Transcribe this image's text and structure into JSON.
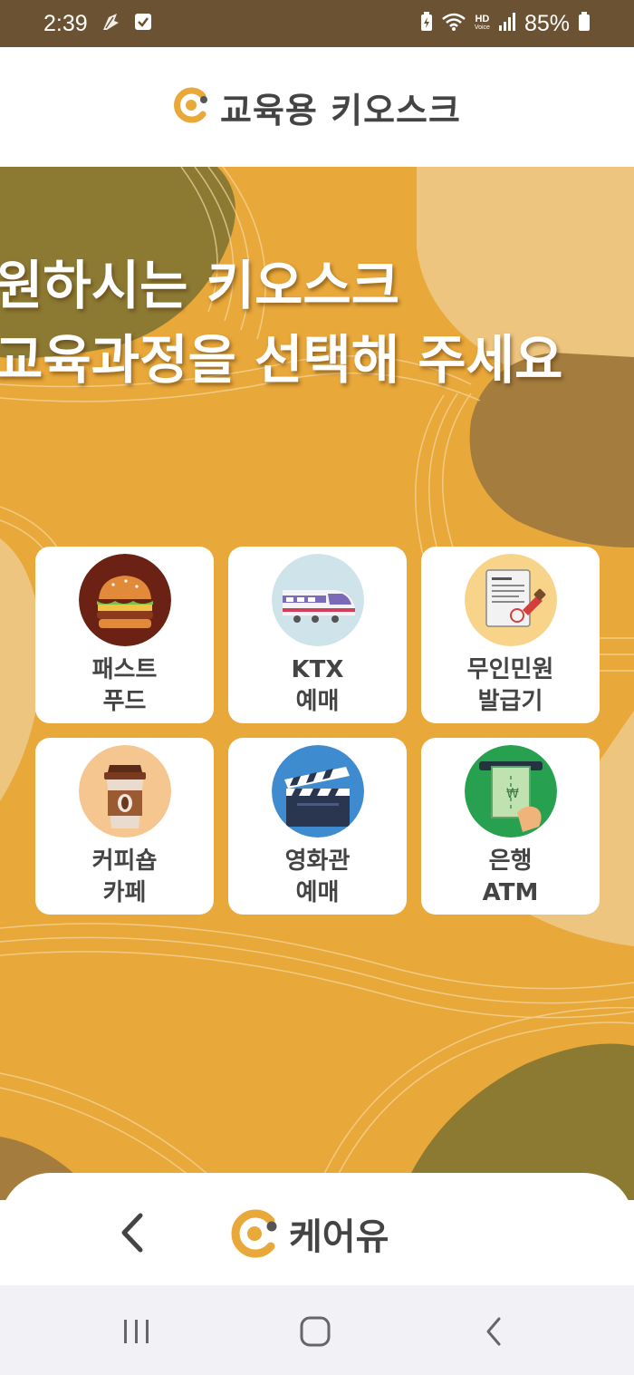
{
  "status_bar": {
    "time": "2:39",
    "battery": "85%",
    "network_label": "HD",
    "network_sublabel": "Voice",
    "icons": [
      "notification-icon",
      "checkbox-notification-icon",
      "battery-saver-icon",
      "wifi-icon",
      "signal-icon",
      "battery-icon"
    ]
  },
  "header": {
    "title": "교육용 키오스크",
    "logo_icon": "careu-logo-icon",
    "brand_color": "#e9a83a"
  },
  "main": {
    "headline_line1": "원하시는 키오스크",
    "headline_line2": "교육과정을 선택해 주세요",
    "background_color": "#e9a83a",
    "items": [
      {
        "icon": "burger-icon",
        "line1": "패스트",
        "line2": "푸드"
      },
      {
        "icon": "train-icon",
        "line1": "KTX",
        "line2": "예매"
      },
      {
        "icon": "document-stamp-icon",
        "line1": "무인민원",
        "line2": "발급기"
      },
      {
        "icon": "coffee-cup-icon",
        "line1": "커피숍",
        "line2": "카페"
      },
      {
        "icon": "clapperboard-icon",
        "line1": "영화관",
        "line2": "예매"
      },
      {
        "icon": "atm-cash-icon",
        "line1": "은행",
        "line2": "ATM"
      }
    ]
  },
  "bottom_bar": {
    "back_icon": "chevron-left-icon",
    "brand_name": "케어유"
  },
  "nav_bar": {
    "icons": [
      "recent-apps-icon",
      "home-icon",
      "back-icon"
    ]
  }
}
